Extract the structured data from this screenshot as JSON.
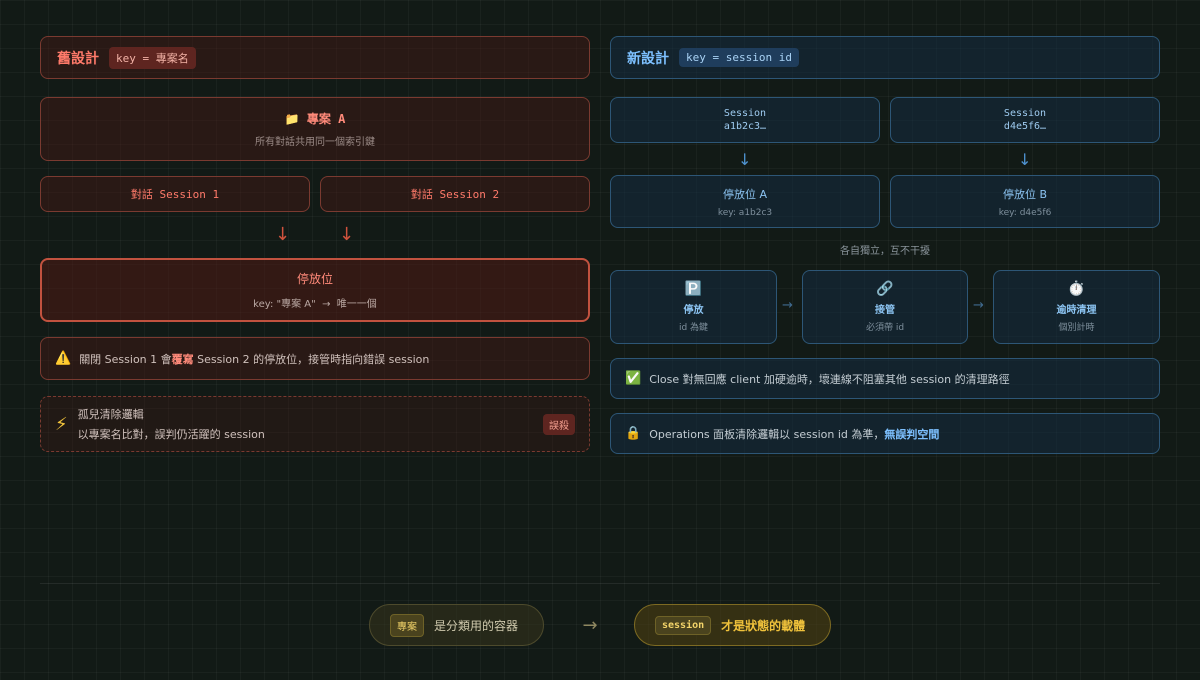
{
  "old_design": {
    "title": "舊設計",
    "key_label": "key = 專案名",
    "project": {
      "icon": "folder-icon",
      "title": "專案 A",
      "subtitle": "所有對話共用同一個索引鍵"
    },
    "sessions": [
      "對話 Session 1",
      "對話 Session 2"
    ],
    "parking": {
      "title": "停放位",
      "subtitle": "key: \"專案 A\"  →  唯一一個"
    },
    "warning": {
      "icon": "warning-icon",
      "text_before": "關閉 Session 1 會",
      "text_highlight": "覆寫",
      "text_after": " Session 2 的停放位，接管時指向錯誤 session"
    },
    "orphan": {
      "icon": "lightning-icon",
      "title": "孤兒清除邏輯",
      "subtitle": "以專案名比對，誤判仍活躍的 session",
      "tag": "誤殺"
    }
  },
  "new_design": {
    "title": "新設計",
    "key_label": "key = session id",
    "sessions": [
      {
        "line1": "Session",
        "line2": "a1b2c3…"
      },
      {
        "line1": "Session",
        "line2": "d4e5f6…"
      }
    ],
    "parkings": [
      {
        "title": "停放位 A",
        "subtitle": "key: a1b2c3"
      },
      {
        "title": "停放位 B",
        "subtitle": "key: d4e5f6"
      }
    ],
    "independent_note": "各自獨立，互不干擾",
    "steps": [
      {
        "icon": "parking-icon",
        "glyph": "🅿️",
        "title": "停放",
        "subtitle": "id 為鍵"
      },
      {
        "icon": "link-icon",
        "glyph": "🔗",
        "title": "接管",
        "subtitle": "必須帶 id"
      },
      {
        "icon": "stopwatch-icon",
        "glyph": "⏱️",
        "title": "逾時清理",
        "subtitle": "個別計時"
      }
    ],
    "close_note": {
      "icon": "check-icon",
      "text": "Close 對無回應 client 加硬逾時，壞連線不阻塞其他 session 的清理路徑"
    },
    "ops_note": {
      "icon": "lock-icon",
      "text_before": "Operations 面板清除邏輯以 session id 為準，",
      "text_highlight": "無誤判空間"
    }
  },
  "summary": {
    "left_chip": "專案",
    "left_text": "是分類用的容器",
    "arrow": "→",
    "right_chip": "session",
    "right_text": "才是狀態的載體"
  },
  "colors": {
    "old_accent": "#ff7a6a",
    "new_accent": "#7dc0ff",
    "summary_accent": "#f0c23b"
  }
}
